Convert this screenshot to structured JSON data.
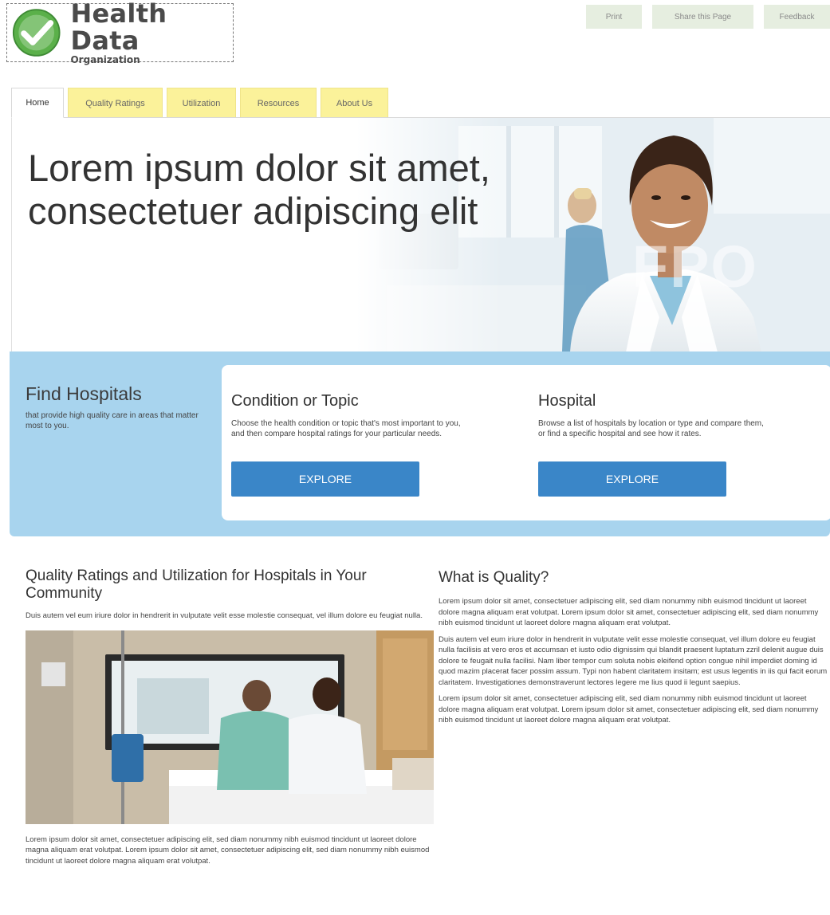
{
  "brand": {
    "title": "Health Data",
    "subtitle": "Organization",
    "colors": {
      "check": "#5bb04a",
      "accent": "#3a86c8",
      "band": "#a8d4ee",
      "tab": "#fbf29a"
    }
  },
  "top_actions": [
    {
      "label": "Print"
    },
    {
      "label": "Share this Page"
    },
    {
      "label": "Feedback"
    }
  ],
  "tabs": [
    {
      "label": "Home",
      "active": true
    },
    {
      "label": "Quality Ratings"
    },
    {
      "label": "Utilization"
    },
    {
      "label": "Resources"
    },
    {
      "label": "About Us"
    }
  ],
  "hero": {
    "title_line1": "Lorem ipsum dolor sit amet,",
    "title_line2": "consectetuer adipiscing elit",
    "watermark": "FPO"
  },
  "find": {
    "title": "Find Hospitals",
    "subtitle": " that provide high quality care in areas that matter most to you.",
    "condition": {
      "heading": "Condition or Topic",
      "text": "Choose the health condition or topic that's most important to you, and then compare hospital ratings for your particular needs.",
      "button": "EXPLORE"
    },
    "hospital": {
      "heading": "Hospital",
      "text": "Browse a list of hospitals by location or type and compare them, or find a specific hospital and see how it rates.",
      "button": "EXPLORE"
    }
  },
  "quality_section": {
    "title": "Quality Ratings and Utilization for Hospitals in Your Community",
    "intro": "Duis autem vel eum iriure dolor in hendrerit in vulputate velit esse molestie consequat, vel illum dolore eu feugiat nulla.",
    "after": "Lorem ipsum dolor sit amet, consectetuer adipiscing elit, sed diam nonummy nibh euismod tincidunt ut laoreet dolore magna aliquam erat volutpat. Lorem ipsum dolor sit amet, consectetuer adipiscing elit, sed diam nonummy nibh euismod tincidunt ut laoreet dolore magna aliquam erat volutpat."
  },
  "what_is_quality": {
    "title": "What is Quality?",
    "p1": "Lorem ipsum dolor sit amet, consectetuer adipiscing elit, sed diam nonummy nibh euismod tincidunt ut laoreet dolore magna aliquam erat volutpat. Lorem ipsum dolor sit amet, consectetuer adipiscing elit, sed diam nonummy nibh euismod tincidunt ut laoreet dolore magna aliquam erat volutpat.",
    "p2": "Duis autem vel eum iriure dolor in hendrerit in vulputate velit esse molestie consequat, vel illum dolore eu feugiat nulla facilisis at vero eros et accumsan et iusto odio dignissim qui blandit praesent luptatum zzril delenit augue duis dolore te feugait nulla facilisi. Nam liber tempor cum soluta nobis eleifend option congue nihil imperdiet doming id quod mazim placerat facer possim assum. Typi non habent claritatem insitam; est usus legentis in iis qui facit eorum claritatem. Investigationes demonstraverunt lectores legere me lius quod ii legunt saepius.",
    "p3": "Lorem ipsum dolor sit amet, consectetuer adipiscing elit, sed diam nonummy nibh euismod tincidunt ut laoreet dolore magna aliquam erat volutpat. Lorem ipsum dolor sit amet, consectetuer adipiscing elit, sed diam nonummy nibh euismod tincidunt ut laoreet dolore magna aliquam erat volutpat."
  }
}
